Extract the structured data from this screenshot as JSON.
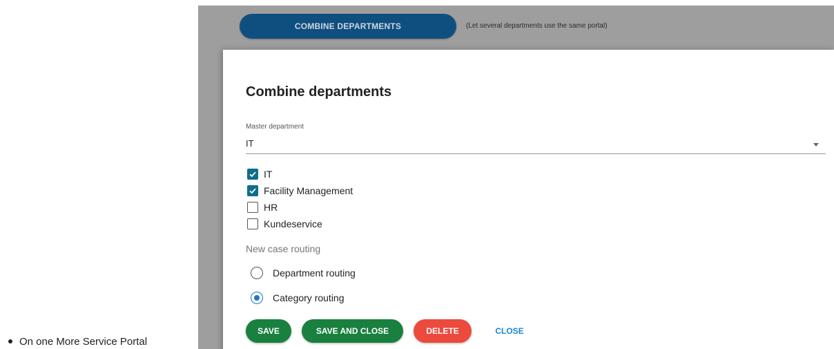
{
  "bullet": {
    "text": "On one More Service Portal"
  },
  "background": {
    "combine_button": "COMBINE DEPARTMENTS",
    "combine_hint": "(Let several departments use the same portal)"
  },
  "dialog": {
    "title": "Combine departments",
    "master_department": {
      "label": "Master department",
      "value": "IT"
    },
    "departments": [
      {
        "label": "IT",
        "checked": true
      },
      {
        "label": "Facility Management",
        "checked": true
      },
      {
        "label": "HR",
        "checked": false
      },
      {
        "label": "Kundeservice",
        "checked": false
      }
    ],
    "routing": {
      "label": "New case routing",
      "options": [
        {
          "label": "Department routing",
          "selected": false
        },
        {
          "label": "Category routing",
          "selected": true
        }
      ]
    },
    "buttons": {
      "save": "SAVE",
      "save_and_close": "SAVE AND CLOSE",
      "delete": "DELETE",
      "close": "CLOSE"
    }
  },
  "colors": {
    "primary_dark": "#0f4f80",
    "checkbox": "#0f6e8c",
    "radio": "#1976d2",
    "save": "#19803f",
    "delete": "#ec4a3d",
    "link": "#1e88c7"
  }
}
